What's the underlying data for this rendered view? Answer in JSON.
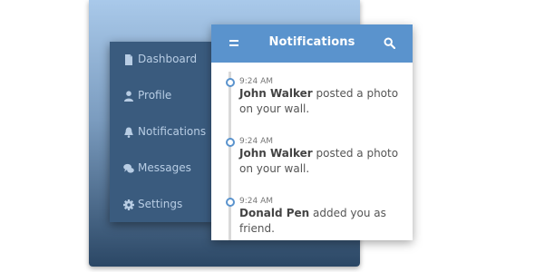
{
  "sidebar": {
    "items": [
      {
        "label": "Dashboard",
        "icon": "file-icon"
      },
      {
        "label": "Profile",
        "icon": "user-icon"
      },
      {
        "label": "Notifications",
        "icon": "bell-icon"
      },
      {
        "label": "Messages",
        "icon": "chat-icon"
      },
      {
        "label": "Settings",
        "icon": "gear-icon"
      }
    ]
  },
  "notifications": {
    "title": "Notifications",
    "items": [
      {
        "time": "9:24 AM",
        "name": "John Walker",
        "text": "posted a photo on your wall."
      },
      {
        "time": "9:24 AM",
        "name": "John Walker",
        "text": "posted a photo on your wall."
      },
      {
        "time": "9:24 AM",
        "name": "Donald Pen",
        "text": "added you as friend."
      }
    ]
  },
  "colors": {
    "header": "#5a93cd",
    "sidebar": "#3a5b7e",
    "sidebar_text": "#b8cde4",
    "timeline_dot": "#5a93cd"
  }
}
